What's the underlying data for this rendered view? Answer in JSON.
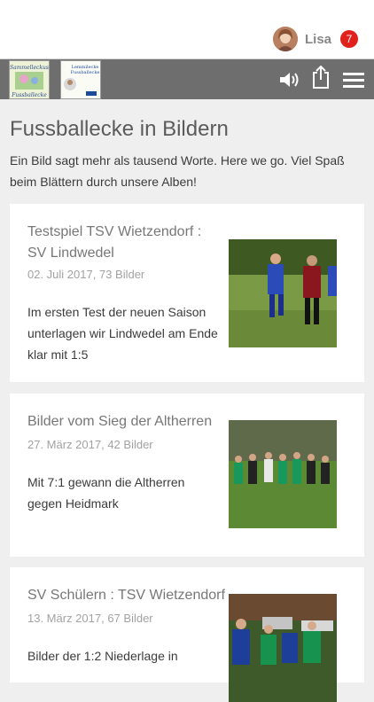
{
  "user": {
    "name": "Lisa",
    "notifications": "7"
  },
  "toolbar": {
    "logo1_alt": "Sammelleckus Fussballecke",
    "logo2_alt": "Lemmilecke Fussballecke"
  },
  "page": {
    "title": "Fussballecke in Bildern",
    "intro": "Ein Bild sagt mehr als tausend Worte. Here we go. Viel Spaß beim Blättern durch unsere Alben!"
  },
  "albums": [
    {
      "title": "Testspiel TSV Wietzendorf : SV Lindwedel",
      "meta": "02. Juli 2017, 73 Bilder",
      "text": "Im ersten Test der neuen Saison unterlagen wir Lindwedel am Ende klar mit 1:5"
    },
    {
      "title": "Bilder vom Sieg der Altherren",
      "meta": "27. März 2017, 42 Bilder",
      "text": "Mit 7:1 gewann die Altherren gegen Heidmark"
    },
    {
      "title": "SV Schülern : TSV Wietzendorf",
      "meta": "13. März 2017, 67 Bilder",
      "text": "Bilder der 1:2 Niederlage in"
    }
  ],
  "colors": {
    "badge": "#e0211c",
    "toolbar": "#6e6e6e",
    "background": "#efefef"
  },
  "icons": [
    "speaker-icon",
    "share-icon",
    "menu-icon"
  ]
}
